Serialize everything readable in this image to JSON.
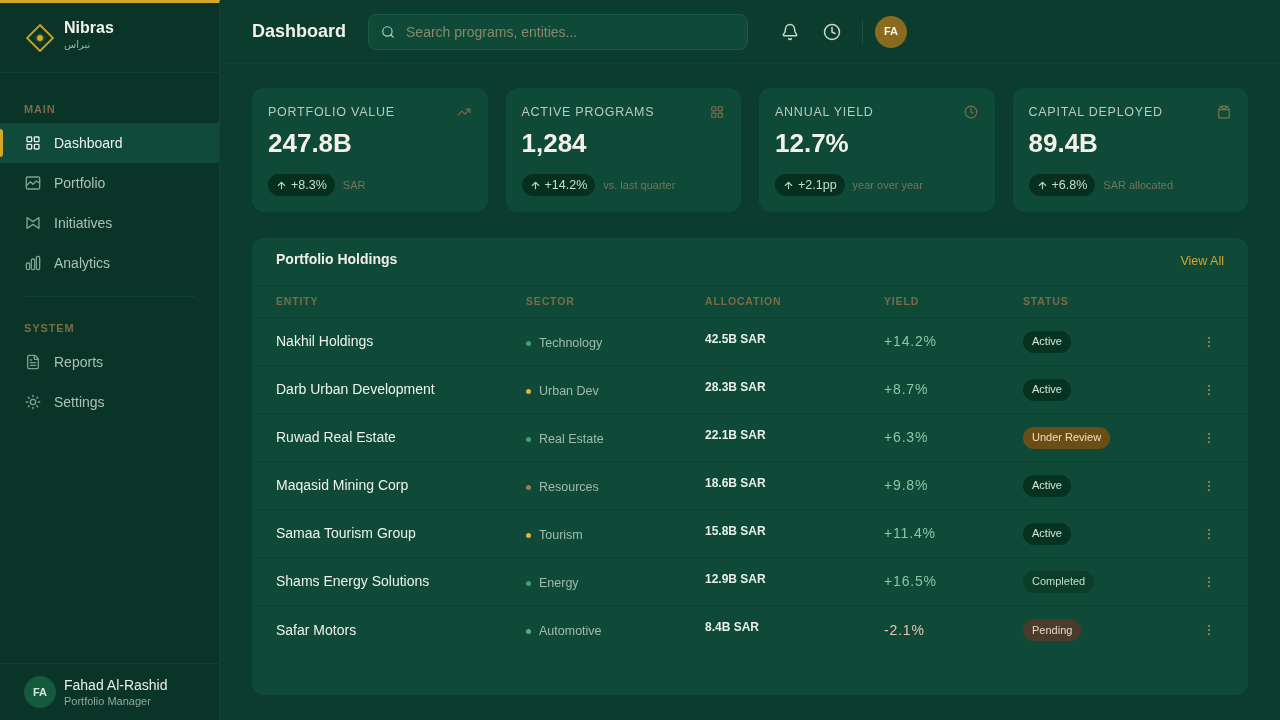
{
  "sidebar": {
    "brand": {
      "name": "Nibras",
      "subtitle": "نبراس"
    },
    "sections": [
      {
        "title": "MAIN",
        "items": [
          {
            "label": "Dashboard",
            "selected": true
          },
          {
            "label": "Portfolio",
            "selected": false
          },
          {
            "label": "Initiatives",
            "selected": false
          },
          {
            "label": "Analytics",
            "selected": false
          }
        ]
      },
      {
        "title": "SYSTEM",
        "items": [
          {
            "label": "Reports",
            "selected": false
          },
          {
            "label": "Settings",
            "selected": false
          }
        ]
      }
    ],
    "user": {
      "initials": "FA",
      "name": "Fahad Al-Rashid",
      "role": "Portfolio Manager"
    }
  },
  "header": {
    "title": "Dashboard",
    "search": {
      "placeholder": "Search programs, entities..."
    },
    "avatar": "FA"
  },
  "kpis": [
    {
      "label": "PORTFOLIO VALUE",
      "value": "247.8B",
      "change": "+8.3%",
      "note": "SAR"
    },
    {
      "label": "ACTIVE PROGRAMS",
      "value": "1,284",
      "change": "+14.2%",
      "note": "vs. last quarter"
    },
    {
      "label": "ANNUAL YIELD",
      "value": "12.7%",
      "change": "+2.1pp",
      "note": "year over year"
    },
    {
      "label": "CAPITAL DEPLOYED",
      "value": "89.4B",
      "change": "+6.8%",
      "note": "SAR allocated"
    }
  ],
  "holdings": {
    "title": "Portfolio Holdings",
    "link": "View All",
    "columns": [
      "ENTITY",
      "SECTOR",
      "ALLOCATION",
      "YIELD",
      "STATUS"
    ],
    "rows": [
      {
        "entity": "Nakhil Holdings",
        "sector": {
          "label": "Technology",
          "color": "#3da36c"
        },
        "allocation": "42.5B SAR",
        "yield": "+14.2%",
        "negative": false,
        "status": {
          "label": "Active",
          "kind": "active"
        }
      },
      {
        "entity": "Darb Urban Development",
        "sector": {
          "label": "Urban Dev",
          "color": "#e0b43a"
        },
        "allocation": "28.3B SAR",
        "yield": "+8.7%",
        "negative": false,
        "status": {
          "label": "Active",
          "kind": "active"
        }
      },
      {
        "entity": "Ruwad Real Estate",
        "sector": {
          "label": "Real Estate",
          "color": "#3da36c"
        },
        "allocation": "22.1B SAR",
        "yield": "+6.3%",
        "negative": false,
        "status": {
          "label": "Under Review",
          "kind": "review"
        }
      },
      {
        "entity": "Maqasid Mining Corp",
        "sector": {
          "label": "Resources",
          "color": "#9a7d55"
        },
        "allocation": "18.6B SAR",
        "yield": "+9.8%",
        "negative": false,
        "status": {
          "label": "Active",
          "kind": "active"
        }
      },
      {
        "entity": "Samaa Tourism Group",
        "sector": {
          "label": "Tourism",
          "color": "#e0b43a"
        },
        "allocation": "15.8B SAR",
        "yield": "+11.4%",
        "negative": false,
        "status": {
          "label": "Active",
          "kind": "active"
        }
      },
      {
        "entity": "Shams Energy Solutions",
        "sector": {
          "label": "Energy",
          "color": "#3da36c"
        },
        "allocation": "12.9B SAR",
        "yield": "+16.5%",
        "negative": false,
        "status": {
          "label": "Completed",
          "kind": "completed"
        }
      },
      {
        "entity": "Safar Motors",
        "sector": {
          "label": "Automotive",
          "color": "#55b07f"
        },
        "allocation": "8.4B SAR",
        "yield": "-2.1%",
        "negative": true,
        "status": {
          "label": "Pending",
          "kind": "pending"
        }
      }
    ]
  }
}
